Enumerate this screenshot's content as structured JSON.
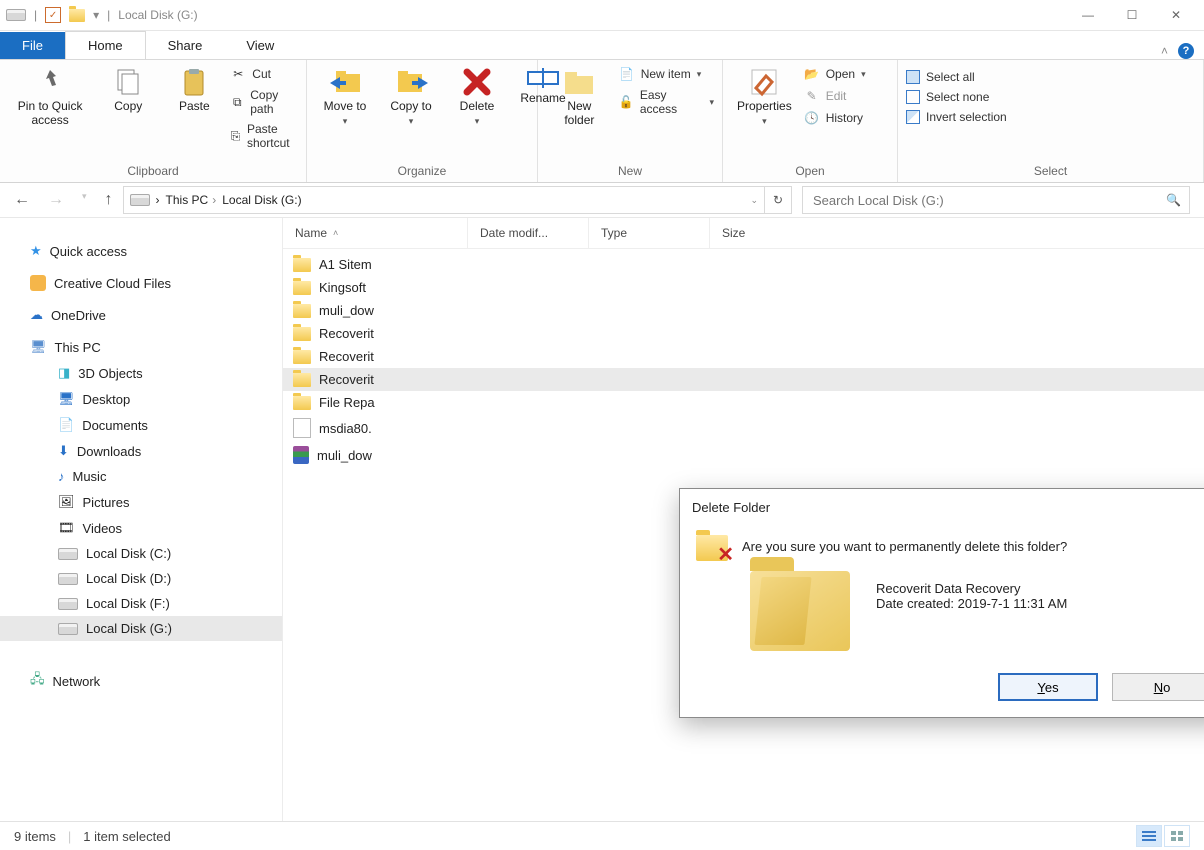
{
  "titlebar": {
    "title": "Local Disk (G:)"
  },
  "tabs": {
    "file": "File",
    "home": "Home",
    "share": "Share",
    "view": "View"
  },
  "ribbon": {
    "clipboard": {
      "label": "Clipboard",
      "pin": "Pin to Quick access",
      "copy": "Copy",
      "paste": "Paste",
      "cut": "Cut",
      "copypath": "Copy path",
      "pasteshort": "Paste shortcut"
    },
    "organize": {
      "label": "Organize",
      "moveto": "Move to",
      "copyto": "Copy to",
      "delete": "Delete",
      "rename": "Rename"
    },
    "new": {
      "label": "New",
      "newfolder": "New folder",
      "newitem": "New item",
      "easyaccess": "Easy access"
    },
    "open": {
      "label": "Open",
      "properties": "Properties",
      "open": "Open",
      "edit": "Edit",
      "history": "History"
    },
    "select": {
      "label": "Select",
      "all": "Select all",
      "none": "Select none",
      "invert": "Invert selection"
    }
  },
  "address": {
    "thispc": "This PC",
    "loc": "Local Disk (G:)",
    "search_placeholder": "Search Local Disk (G:)"
  },
  "columns": {
    "name": "Name",
    "date": "Date modif...",
    "type": "Type",
    "size": "Size"
  },
  "sidebar": {
    "quick": "Quick access",
    "ccf": "Creative Cloud Files",
    "onedrive": "OneDrive",
    "thispc": "This PC",
    "obj3d": "3D Objects",
    "desktop": "Desktop",
    "documents": "Documents",
    "downloads": "Downloads",
    "music": "Music",
    "pictures": "Pictures",
    "videos": "Videos",
    "diskc": "Local Disk (C:)",
    "diskd": "Local Disk (D:)",
    "diskf": "Local Disk (F:)",
    "diskg": "Local Disk (G:)",
    "network": "Network"
  },
  "files": {
    "f1": "A1 Sitem",
    "f2": "Kingsoft",
    "f3": "muli_dow",
    "f4": "Recoverit",
    "f5": "Recoverit",
    "f6": "Recoverit",
    "f7": "File Repa",
    "f8": "msdia80.",
    "f9": "muli_dow"
  },
  "dialog": {
    "title": "Delete Folder",
    "question": "Are you sure you want to permanently delete this folder?",
    "item_name": "Recoverit Data Recovery",
    "item_date": "Date created: 2019-7-1 11:31 AM",
    "yes": "Yes",
    "no": "No"
  },
  "status": {
    "count": "9 items",
    "sel": "1 item selected"
  }
}
